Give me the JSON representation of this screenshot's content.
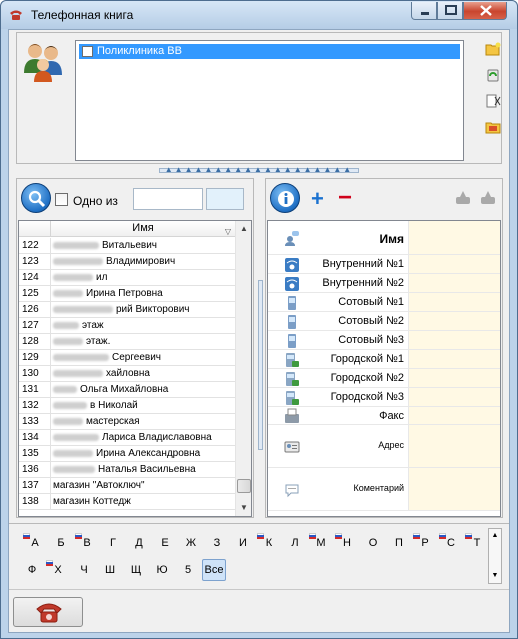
{
  "window": {
    "title": "Телефонная книга"
  },
  "groups": {
    "items": [
      {
        "label": "Поликлиника ВВ",
        "checked": false,
        "selected": true
      }
    ]
  },
  "search": {
    "one_of_label": "Одно из",
    "one_of_checked": false,
    "query_value": "",
    "second_value": ""
  },
  "contacts": {
    "column_name": "Имя",
    "rows": [
      {
        "num": "122",
        "name": "Витальевич"
      },
      {
        "num": "123",
        "name": "Владимирович"
      },
      {
        "num": "124",
        "name": "ил"
      },
      {
        "num": "125",
        "name": "Ирина Петровна"
      },
      {
        "num": "126",
        "name": "рий Викторович"
      },
      {
        "num": "127",
        "name": "этаж"
      },
      {
        "num": "128",
        "name": "этаж."
      },
      {
        "num": "129",
        "name": "Сергеевич"
      },
      {
        "num": "130",
        "name": "хайловна"
      },
      {
        "num": "131",
        "name": "Ольга Михайловна"
      },
      {
        "num": "132",
        "name": "в Николай"
      },
      {
        "num": "133",
        "name": "мастерская"
      },
      {
        "num": "134",
        "name": "Лариса Владиславовна"
      },
      {
        "num": "135",
        "name": "Ирина Александровна"
      },
      {
        "num": "136",
        "name": "Наталья Васильевна"
      },
      {
        "num": "137",
        "name": "магазин \"Автоключ\""
      },
      {
        "num": "138",
        "name": "магазин Коттедж"
      }
    ]
  },
  "details": {
    "fields": [
      {
        "label": "Имя",
        "icon": "user-speech-icon"
      },
      {
        "label": "Внутренний №1",
        "icon": "desk-phone-icon"
      },
      {
        "label": "Внутренний №2",
        "icon": "desk-phone-icon"
      },
      {
        "label": "Сотовый №1",
        "icon": "mobile-phone-icon"
      },
      {
        "label": "Сотовый №2",
        "icon": "mobile-phone-icon"
      },
      {
        "label": "Сотовый №3",
        "icon": "mobile-phone-icon"
      },
      {
        "label": "Городской №1",
        "icon": "city-phone-icon"
      },
      {
        "label": "Городской №2",
        "icon": "city-phone-icon"
      },
      {
        "label": "Городской №3",
        "icon": "city-phone-icon"
      },
      {
        "label": "Факс",
        "icon": "fax-icon"
      },
      {
        "label": "Адрес",
        "icon": "address-card-icon"
      },
      {
        "label": "Коментарий",
        "icon": "comment-icon"
      }
    ]
  },
  "alphabet": {
    "row1": [
      "А",
      "Б",
      "В",
      "Г",
      "Д",
      "Е",
      "Ж",
      "З",
      "И",
      "К",
      "Л",
      "М",
      "Н",
      "О",
      "П",
      "Р",
      "С",
      "Т"
    ],
    "row2": [
      "Ф",
      "Х",
      "Ч",
      "Ш",
      "Щ",
      "Ю",
      "5",
      "Все"
    ],
    "flagged": [
      "А",
      "В",
      "К",
      "М",
      "Н",
      "Р",
      "С",
      "Т",
      "Х"
    ],
    "active": "Все"
  },
  "colors": {
    "selection": "#3399ff",
    "value_bg": "#fff9e4",
    "accent_blue": "#1b72d0",
    "accent_red": "#d0021b"
  }
}
